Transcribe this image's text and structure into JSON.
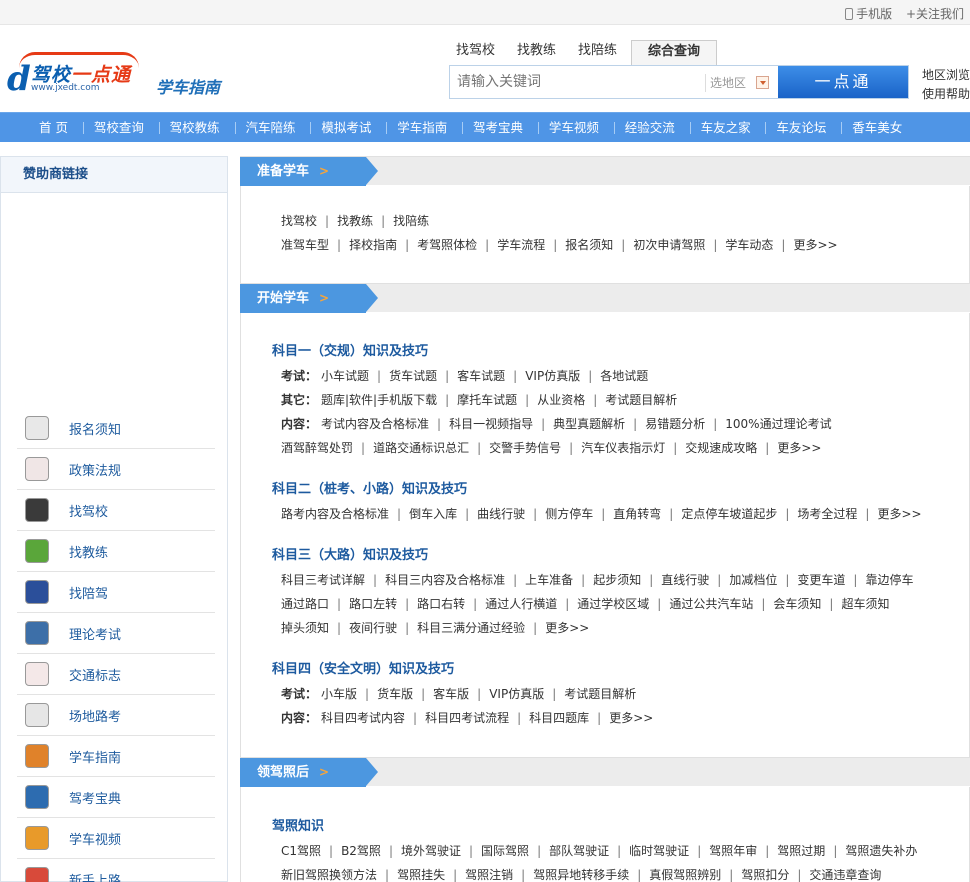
{
  "topbar": {
    "mobile": "手机版",
    "follow": "+关注我们"
  },
  "header": {
    "logo_main_a": "驾校",
    "logo_main_b": "一点通",
    "logo_d": "d",
    "logo_url": "www.jxedt.com",
    "site_sub": "学车指南",
    "search_tabs": [
      "找驾校",
      "找教练",
      "找陪练",
      "综合查询"
    ],
    "search_placeholder": "请输入关键词",
    "region_select": "选地区",
    "search_button": "一点通",
    "right_links": [
      "地区浏览",
      "使用帮助"
    ]
  },
  "nav": [
    "首 页",
    "驾校查询",
    "驾校教练",
    "汽车陪练",
    "模拟考试",
    "学车指南",
    "驾考宝典",
    "学车视频",
    "经验交流",
    "车友之家",
    "车友论坛",
    "香车美女"
  ],
  "sidebar": {
    "title": "赞助商链接",
    "items": [
      {
        "label": "报名须知",
        "icon": "steering-wheel-icon",
        "color": "#e8e8e8"
      },
      {
        "label": "政策法规",
        "icon": "no-entry-icon",
        "color": "#f0e6e6"
      },
      {
        "label": "找驾校",
        "icon": "car-icon",
        "color": "#3a3a3a"
      },
      {
        "label": "找教练",
        "icon": "thumbs-up-icon",
        "color": "#5aa63a"
      },
      {
        "label": "找陪驾",
        "icon": "people-icon",
        "color": "#2b4f9a"
      },
      {
        "label": "理论考试",
        "icon": "exam-icon",
        "color": "#3d6fa8"
      },
      {
        "label": "交通标志",
        "icon": "traffic-sign-icon",
        "color": "#f4e8e8"
      },
      {
        "label": "场地路考",
        "icon": "road-test-icon",
        "color": "#e6e6e6"
      },
      {
        "label": "学车指南",
        "icon": "guide-icon",
        "color": "#e0822a"
      },
      {
        "label": "驾考宝典",
        "icon": "speedometer-icon",
        "color": "#2d6cb0"
      },
      {
        "label": "学车视频",
        "icon": "film-icon",
        "color": "#e89a2a"
      },
      {
        "label": "新手上路",
        "icon": "first-aid-icon",
        "color": "#d84a3a"
      }
    ]
  },
  "sections": {
    "prepare": {
      "title": "准备学车",
      "row1": [
        "找驾校",
        "找教练",
        "找陪练"
      ],
      "row2": [
        "准驾车型",
        "择校指南",
        "考驾照体检",
        "学车流程",
        "报名须知",
        "初次申请驾照",
        "学车动态",
        "更多>>"
      ]
    },
    "start": {
      "title": "开始学车",
      "k1": {
        "title": "科目一（交规）知识及技巧",
        "exam_label": "考试：",
        "exam": [
          "小车试题",
          "货车试题",
          "客车试题",
          "VIP仿真版",
          "各地试题"
        ],
        "other_label": "其它：",
        "other": [
          "题库|软件|手机版下载",
          "摩托车试题",
          "从业资格",
          "考试题目解析"
        ],
        "content_label": "内容：",
        "content": [
          "考试内容及合格标准",
          "科目一视频指导",
          "典型真题解析",
          "易错题分析",
          "100%通过理论考试"
        ],
        "content2": [
          "酒驾醉驾处罚",
          "道路交通标识总汇",
          "交警手势信号",
          "汽车仪表指示灯",
          "交规速成攻略",
          "更多>>"
        ]
      },
      "k2": {
        "title": "科目二（桩考、小路）知识及技巧",
        "row": [
          "路考内容及合格标准",
          "倒车入库",
          "曲线行驶",
          "侧方停车",
          "直角转弯",
          "定点停车坡道起步",
          "场考全过程",
          "更多>>"
        ]
      },
      "k3": {
        "title": "科目三（大路）知识及技巧",
        "row1": [
          "科目三考试详解",
          "科目三内容及合格标准",
          "上车准备",
          "起步须知",
          "直线行驶",
          "加减档位",
          "变更车道",
          "靠边停车"
        ],
        "row2": [
          "通过路口",
          "路口左转",
          "路口右转",
          "通过人行横道",
          "通过学校区域",
          "通过公共汽车站",
          "会车须知",
          "超车须知"
        ],
        "row3": [
          "掉头须知",
          "夜间行驶",
          "科目三满分通过经验",
          "更多>>"
        ]
      },
      "k4": {
        "title": "科目四（安全文明）知识及技巧",
        "exam_label": "考试：",
        "exam": [
          "小车版",
          "货车版",
          "客车版",
          "VIP仿真版",
          "考试题目解析"
        ],
        "content_label": "内容：",
        "content": [
          "科目四考试内容",
          "科目四考试流程",
          "科目四题库",
          "更多>>"
        ]
      }
    },
    "license": {
      "title": "领驾照后",
      "knowledge": {
        "title": "驾照知识",
        "row1": [
          "C1驾照",
          "B2驾照",
          "境外驾驶证",
          "国际驾照",
          "部队驾驶证",
          "临时驾驶证",
          "驾照年审",
          "驾照过期",
          "驾照遗失补办"
        ],
        "row2": [
          "新旧驾照换领方法",
          "驾照挂失",
          "驾照注销",
          "驾照异地转移手续",
          "真假驾照辨别",
          "驾照扣分",
          "交通违章查询"
        ]
      }
    }
  },
  "colors": {
    "nav": "#4f95e6",
    "tag": "#4c97e0",
    "title": "#1d5a9f",
    "accent": "#f7a53a"
  }
}
